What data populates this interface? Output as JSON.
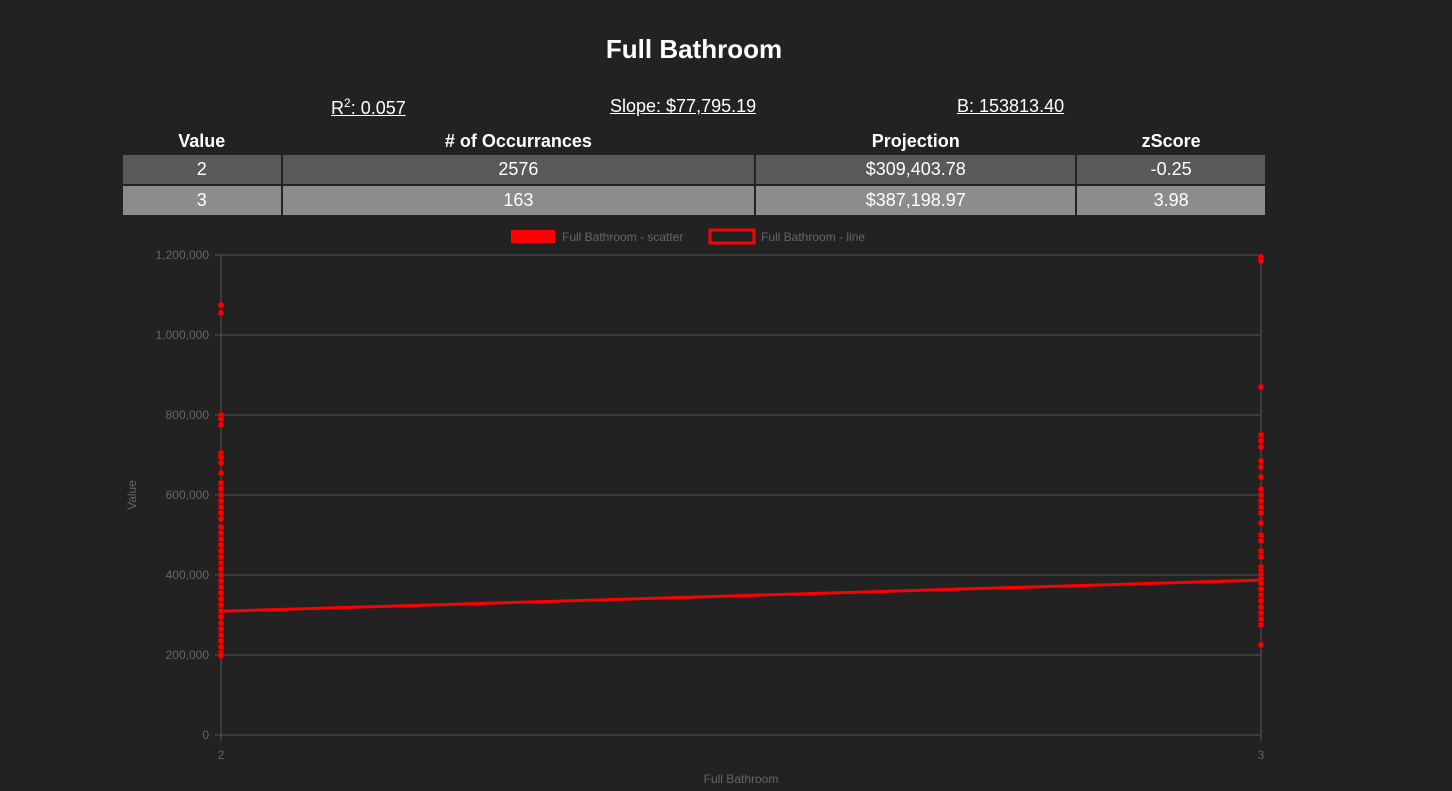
{
  "header": {
    "title": "Full Bathroom",
    "r2_label": "R",
    "r2_sup": "2",
    "r2_value": ": 0.057",
    "slope": "Slope: $77,795.19",
    "b": "B: 153813.40"
  },
  "table": {
    "columns": [
      "Value",
      "# of Occurrances",
      "Projection",
      "zScore"
    ],
    "rows": [
      [
        "2",
        "2576",
        "$309,403.78",
        "-0.25"
      ],
      [
        "3",
        "163",
        "$387,198.97",
        "3.98"
      ]
    ]
  },
  "colors": {
    "background": "#222222",
    "series": "#ff0000",
    "grid": "#555555",
    "axis_text": "#666666"
  },
  "chart_data": {
    "type": "scatter",
    "xlabel": "Full Bathroom",
    "ylabel": "Value",
    "x_ticks": [
      "2",
      "3"
    ],
    "xlim": [
      2,
      3
    ],
    "ylim": [
      0,
      1200000
    ],
    "y_ticks": [
      "0",
      "200,000",
      "400,000",
      "600,000",
      "800,000",
      "1,000,000",
      "1,200,000"
    ],
    "y_tick_values": [
      0,
      200000,
      400000,
      600000,
      800000,
      1000000,
      1200000
    ],
    "grid": true,
    "legend_position": "top",
    "series": [
      {
        "name": "Full Bathroom - scatter",
        "type": "scatter",
        "points": [
          {
            "x": 2,
            "y": 1075000
          },
          {
            "x": 2,
            "y": 1055000
          },
          {
            "x": 2,
            "y": 800000
          },
          {
            "x": 2,
            "y": 790000
          },
          {
            "x": 2,
            "y": 775000
          },
          {
            "x": 2,
            "y": 705000
          },
          {
            "x": 2,
            "y": 695000
          },
          {
            "x": 2,
            "y": 680000
          },
          {
            "x": 2,
            "y": 655000
          },
          {
            "x": 2,
            "y": 630000
          },
          {
            "x": 2,
            "y": 615000
          },
          {
            "x": 2,
            "y": 600000
          },
          {
            "x": 2,
            "y": 585000
          },
          {
            "x": 2,
            "y": 570000
          },
          {
            "x": 2,
            "y": 555000
          },
          {
            "x": 2,
            "y": 540000
          },
          {
            "x": 2,
            "y": 520000
          },
          {
            "x": 2,
            "y": 505000
          },
          {
            "x": 2,
            "y": 490000
          },
          {
            "x": 2,
            "y": 475000
          },
          {
            "x": 2,
            "y": 460000
          },
          {
            "x": 2,
            "y": 445000
          },
          {
            "x": 2,
            "y": 430000
          },
          {
            "x": 2,
            "y": 415000
          },
          {
            "x": 2,
            "y": 400000
          },
          {
            "x": 2,
            "y": 385000
          },
          {
            "x": 2,
            "y": 370000
          },
          {
            "x": 2,
            "y": 355000
          },
          {
            "x": 2,
            "y": 340000
          },
          {
            "x": 2,
            "y": 325000
          },
          {
            "x": 2,
            "y": 310000
          },
          {
            "x": 2,
            "y": 295000
          },
          {
            "x": 2,
            "y": 280000
          },
          {
            "x": 2,
            "y": 265000
          },
          {
            "x": 2,
            "y": 250000
          },
          {
            "x": 2,
            "y": 235000
          },
          {
            "x": 2,
            "y": 220000
          },
          {
            "x": 2,
            "y": 205000
          },
          {
            "x": 2,
            "y": 198000
          },
          {
            "x": 3,
            "y": 1195000
          },
          {
            "x": 3,
            "y": 1185000
          },
          {
            "x": 3,
            "y": 870000
          },
          {
            "x": 3,
            "y": 750000
          },
          {
            "x": 3,
            "y": 735000
          },
          {
            "x": 3,
            "y": 720000
          },
          {
            "x": 3,
            "y": 685000
          },
          {
            "x": 3,
            "y": 670000
          },
          {
            "x": 3,
            "y": 645000
          },
          {
            "x": 3,
            "y": 615000
          },
          {
            "x": 3,
            "y": 600000
          },
          {
            "x": 3,
            "y": 585000
          },
          {
            "x": 3,
            "y": 570000
          },
          {
            "x": 3,
            "y": 555000
          },
          {
            "x": 3,
            "y": 530000
          },
          {
            "x": 3,
            "y": 500000
          },
          {
            "x": 3,
            "y": 485000
          },
          {
            "x": 3,
            "y": 460000
          },
          {
            "x": 3,
            "y": 445000
          },
          {
            "x": 3,
            "y": 420000
          },
          {
            "x": 3,
            "y": 410000
          },
          {
            "x": 3,
            "y": 400000
          },
          {
            "x": 3,
            "y": 390000
          },
          {
            "x": 3,
            "y": 380000
          },
          {
            "x": 3,
            "y": 365000
          },
          {
            "x": 3,
            "y": 350000
          },
          {
            "x": 3,
            "y": 335000
          },
          {
            "x": 3,
            "y": 320000
          },
          {
            "x": 3,
            "y": 305000
          },
          {
            "x": 3,
            "y": 290000
          },
          {
            "x": 3,
            "y": 275000
          },
          {
            "x": 3,
            "y": 225000
          }
        ]
      },
      {
        "name": "Full Bathroom - line",
        "type": "line",
        "points": [
          {
            "x": 2,
            "y": 309403.78
          },
          {
            "x": 3,
            "y": 387198.97
          }
        ]
      }
    ]
  }
}
